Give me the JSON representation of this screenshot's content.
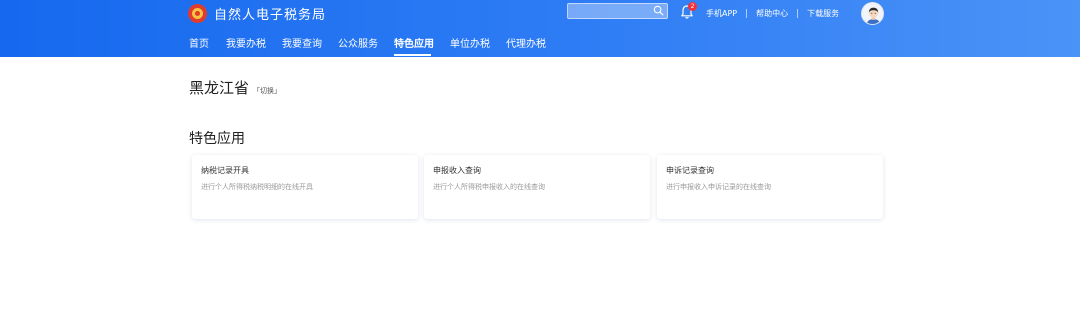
{
  "brand": {
    "name": "自然人电子税务局"
  },
  "search": {
    "placeholder": "",
    "value": ""
  },
  "notifications": {
    "count": "2"
  },
  "top_links": [
    "手机APP",
    "帮助中心",
    "下载服务"
  ],
  "nav": {
    "items": [
      {
        "label": "首页",
        "active": false
      },
      {
        "label": "我要办税",
        "active": false
      },
      {
        "label": "我要查询",
        "active": false
      },
      {
        "label": "公众服务",
        "active": false
      },
      {
        "label": "特色应用",
        "active": true
      },
      {
        "label": "单位办税",
        "active": false
      },
      {
        "label": "代理办税",
        "active": false
      }
    ]
  },
  "location": {
    "province": "黑龙江省",
    "switch_label": "「切换」"
  },
  "section": {
    "title": "特色应用"
  },
  "cards": [
    {
      "title": "纳税记录开具",
      "desc": "进行个人所得税纳税明细的在线开具"
    },
    {
      "title": "申报收入查询",
      "desc": "进行个人所得税申报收入的在线查询"
    },
    {
      "title": "申诉记录查询",
      "desc": "进行申报收入申诉记录的在线查询"
    }
  ],
  "colors": {
    "header_start": "#1668ee",
    "header_end": "#4a93f7",
    "badge": "#f5313a"
  },
  "icons": {
    "logo": "tax-emblem-icon",
    "search": "search-icon",
    "bell": "bell-icon",
    "avatar": "user-avatar"
  }
}
